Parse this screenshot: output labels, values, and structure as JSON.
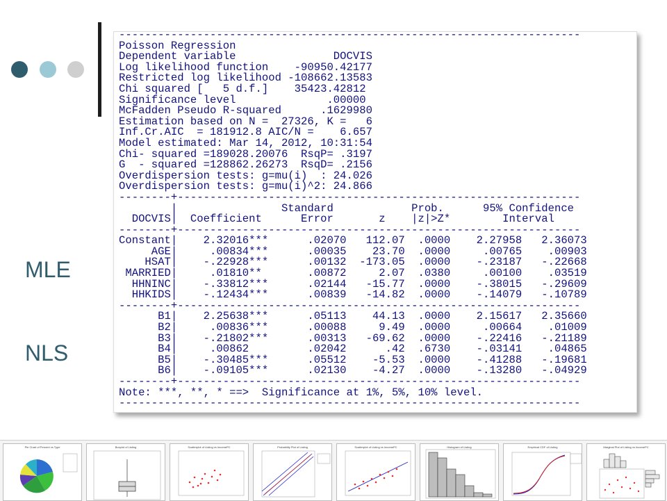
{
  "slide": {
    "colors": {
      "dot_dark": "#2f5d6e",
      "dot_mid": "#9cc9d6",
      "dot_light": "#cfcfcf",
      "label": "#2f5d6e",
      "output_text": "#12127e"
    },
    "side_labels": [
      "MLE",
      "NLS"
    ]
  },
  "output": {
    "lines": [
      "-----------------------------------------------------------------------",
      "Poisson Regression",
      "Dependent variable               DOCVIS",
      "Log likelihood function    -90950.42177",
      "Restricted log likelihood -108662.13583",
      "Chi squared [   5 d.f.]    35423.42812",
      "Significance level              .00000",
      "McFadden Pseudo R-squared      .1629980",
      "Estimation based on N =  27326, K =   6",
      "Inf.Cr.AIC  = 181912.8 AIC/N =    6.657",
      "Model estimated: Mar 14, 2012, 10:31:54",
      "Chi- squared =189028.20076  RsqP= .3197",
      "G  - squared =128862.26273  RsqD= .2156",
      "Overdispersion tests: g=mu(i)  : 24.026",
      "Overdispersion tests: g=mu(i)^2: 24.866",
      "--------+--------------------------------------------------------------",
      "        |                Standard            Prob.      95% Confidence",
      "  DOCVIS|  Coefficient      Error       z    |z|>Z*        Interval",
      "--------+--------------------------------------------------------------",
      "Constant|    2.32016***      .02070   112.07  .0000    2.27958   2.36073",
      "     AGE|     .00834***      .00035    23.70  .0000     .00765    .00903",
      "    HSAT|    -.22928***      .00132  -173.05  .0000    -.23187   -.22668",
      " MARRIED|     .01810**       .00872     2.07  .0380     .00100    .03519",
      "  HHNINC|    -.33812***      .02144   -15.77  .0000    -.38015   -.29609",
      "  HHKIDS|    -.12434***      .00839   -14.82  .0000    -.14079   -.10789",
      "--------+--------------------------------------------------------------",
      "      B1|    2.25638***      .05113    44.13  .0000    2.15617   2.35660",
      "      B2|     .00836***      .00088     9.49  .0000     .00664    .01009",
      "      B3|    -.21802***      .00313   -69.62  .0000    -.22416   -.21189",
      "      B4|     .00862         .02042      .42  .6730    -.03141    .04865",
      "      B5|    -.30485***      .05512    -5.53  .0000    -.41288   -.19681",
      "      B6|    -.09105***      .02130    -4.27  .0000    -.13280   -.04929",
      "--------+--------------------------------------------------------------",
      "Note: ***, **, * ==>  Significance at 1%, 5%, 10% level.",
      "-----------------------------------------------------------------------"
    ]
  },
  "thumbnails": [
    {
      "name": "thumb-pie-chart",
      "title": "Pie Chart of Percent vs Type"
    },
    {
      "name": "thumb-boxplot",
      "title": "Boxplot of Listing"
    },
    {
      "name": "thumb-scatterplot",
      "title": "Scatterplot of Listing vs IncomePC"
    },
    {
      "name": "thumb-probability-plot",
      "title": "Probability Plot of Listing"
    },
    {
      "name": "thumb-scatter-fit",
      "title": "Scatterplot of Listing vs IncomePC"
    },
    {
      "name": "thumb-histogram",
      "title": "Histogram of Listing"
    },
    {
      "name": "thumb-empirical-cdf",
      "title": "Empirical CDF of Listing"
    },
    {
      "name": "thumb-marginal-plot",
      "title": "Marginal Plot of Listing vs IncomePC"
    }
  ]
}
